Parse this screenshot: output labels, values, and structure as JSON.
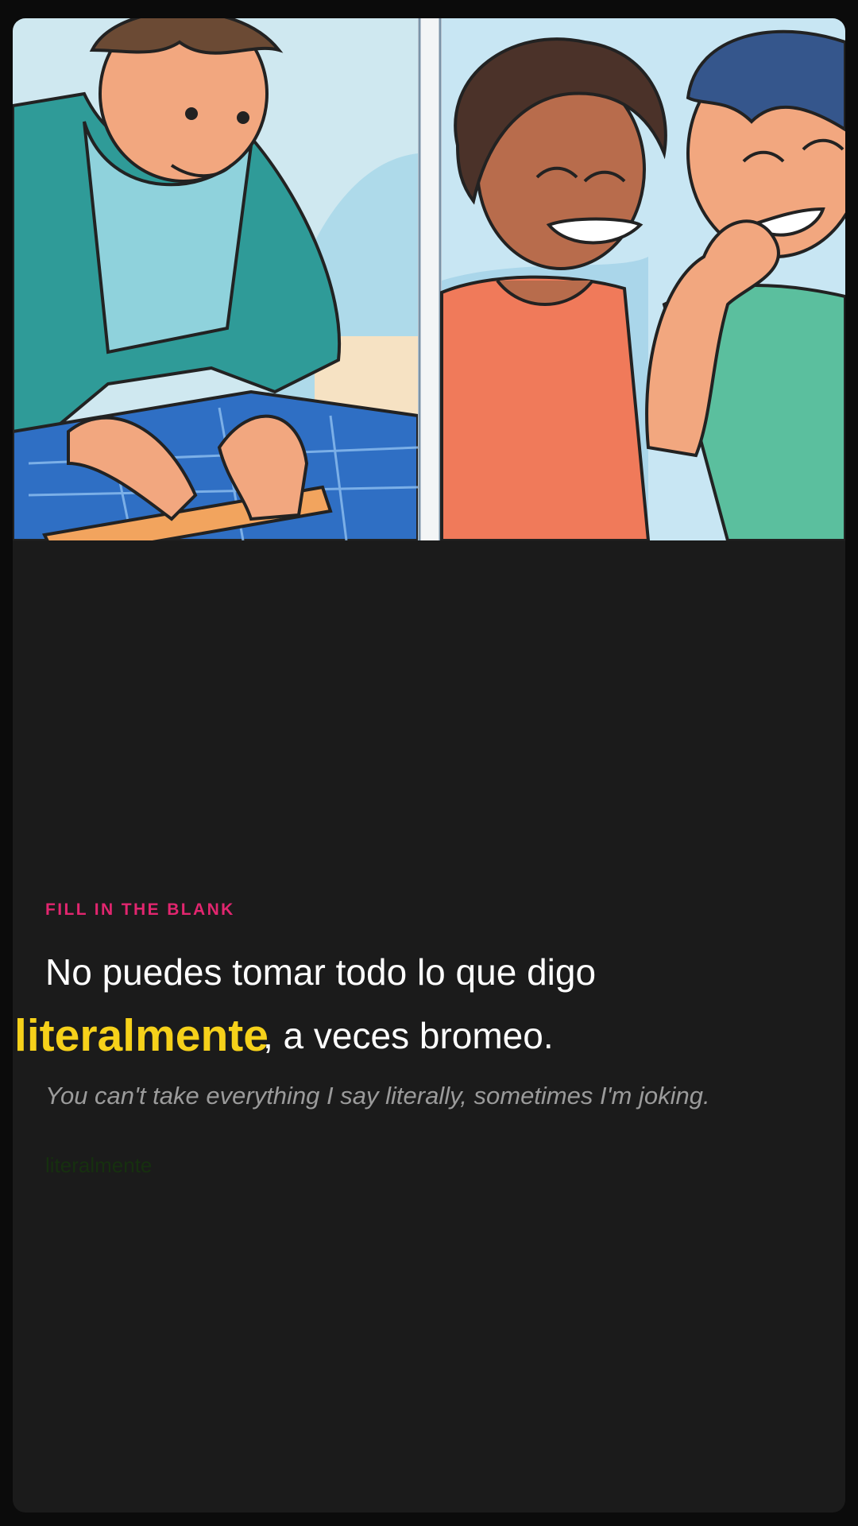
{
  "exercise": {
    "eyebrow": "FILL IN THE BLANK",
    "sentence_line1": "No puedes tomar todo lo que digo",
    "answer": "literalmente",
    "sentence_rest": ", a veces bromeo.",
    "translation": "You can't take everything I say literally, sometimes I'm joking.",
    "hint": "literalmente"
  },
  "illustration": {
    "left_panel": "person-measuring-blueprint",
    "right_panel": "two-people-laughing"
  },
  "colors": {
    "card_bg": "#1b1b1b",
    "eyebrow": "#e2266f",
    "answer": "#f6d11a",
    "translation": "#9b9b9b"
  }
}
